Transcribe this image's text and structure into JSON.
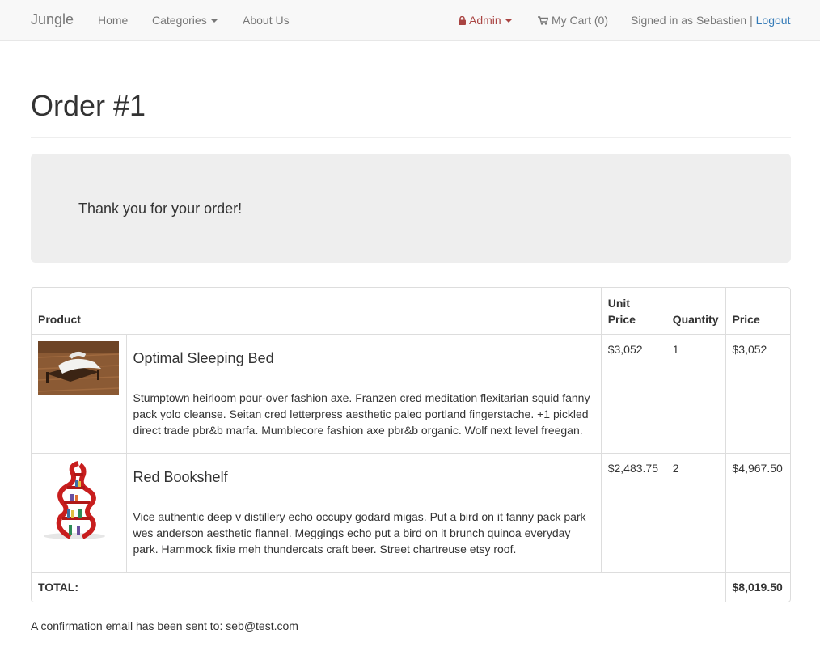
{
  "navbar": {
    "brand": "Jungle",
    "home": "Home",
    "categories": "Categories",
    "about": "About Us",
    "admin": "Admin",
    "cart": "My Cart (0)",
    "signed_in": "Signed in as Sebastien |",
    "logout": "Logout"
  },
  "page": {
    "title": "Order #1",
    "thanks": "Thank you for your order!",
    "confirmation": "A confirmation email has been sent to: seb@test.com"
  },
  "table": {
    "headers": {
      "product": "Product",
      "unit_price_line1": "Unit",
      "unit_price_line2": "Price",
      "quantity": "Quantity",
      "price": "Price"
    },
    "rows": [
      {
        "name": "Optimal Sleeping Bed",
        "description": "Stumptown heirloom pour-over fashion axe. Franzen cred meditation flexitarian squid fanny pack yolo cleanse. Seitan cred letterpress aesthetic paleo portland fingerstache. +1 pickled direct trade pbr&b marfa. Mumblecore fashion axe pbr&b organic. Wolf next level freegan.",
        "unit_price": "$3,052",
        "quantity": "1",
        "price": "$3,052"
      },
      {
        "name": "Red Bookshelf",
        "description": "Vice authentic deep v distillery echo occupy godard migas. Put a bird on it fanny pack park wes anderson aesthetic flannel. Meggings echo put a bird on it brunch quinoa everyday park. Hammock fixie meh thundercats craft beer. Street chartreuse etsy roof.",
        "unit_price": "$2,483.75",
        "quantity": "2",
        "price": "$4,967.50"
      }
    ],
    "total_label": "TOTAL:",
    "total_value": "$8,019.50"
  },
  "colors": {
    "admin": "#a94442",
    "link": "#337ab7",
    "navbar_bg": "#f8f8f8",
    "jumbotron_bg": "#eeeeee"
  }
}
